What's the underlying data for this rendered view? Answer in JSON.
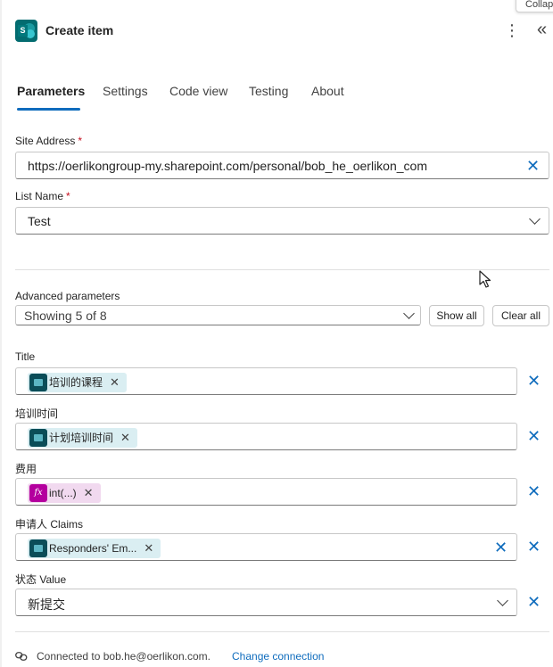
{
  "tooltip": "Collapse",
  "header": {
    "title": "Create item",
    "app_icon_letter": "S",
    "more_glyph": "⋮",
    "collapse_glyph": "«"
  },
  "tabs": [
    {
      "label": "Parameters",
      "active": true
    },
    {
      "label": "Settings",
      "active": false
    },
    {
      "label": "Code view",
      "active": false
    },
    {
      "label": "Testing",
      "active": false
    },
    {
      "label": "About",
      "active": false
    }
  ],
  "site_address": {
    "label": "Site Address",
    "required": "*",
    "value": "https://oerlikongroup-my.sharepoint.com/personal/bob_he_oerlikon_com"
  },
  "list_name": {
    "label": "List Name",
    "required": "*",
    "value": "Test"
  },
  "advanced": {
    "label": "Advanced parameters",
    "value": "Showing 5 of 8",
    "show_all": "Show all",
    "clear_all": "Clear all"
  },
  "params": [
    {
      "label": "Title",
      "token": "培训的课程",
      "token_kind": "dynamic-content"
    },
    {
      "label": "培训时间",
      "token": "计划培训时间",
      "token_kind": "dynamic-content"
    },
    {
      "label": "费用",
      "token": "int(...)",
      "token_kind": "expression",
      "token_icon": "fx"
    },
    {
      "label": "申请人 Claims",
      "token": "Responders' Em...",
      "token_kind": "dynamic-content"
    },
    {
      "label": "状态 Value",
      "value": "新提交"
    }
  ],
  "footer": {
    "connected": "Connected to bob.he@oerlikon.com.",
    "change": "Change connection"
  },
  "colors": {
    "accent": "#0f6cbd",
    "required": "#c50f1f",
    "dynamic_token_bg": "#daeef2",
    "expression_token_bg": "#f1d9ef",
    "expression_icon": "#b4009e"
  }
}
